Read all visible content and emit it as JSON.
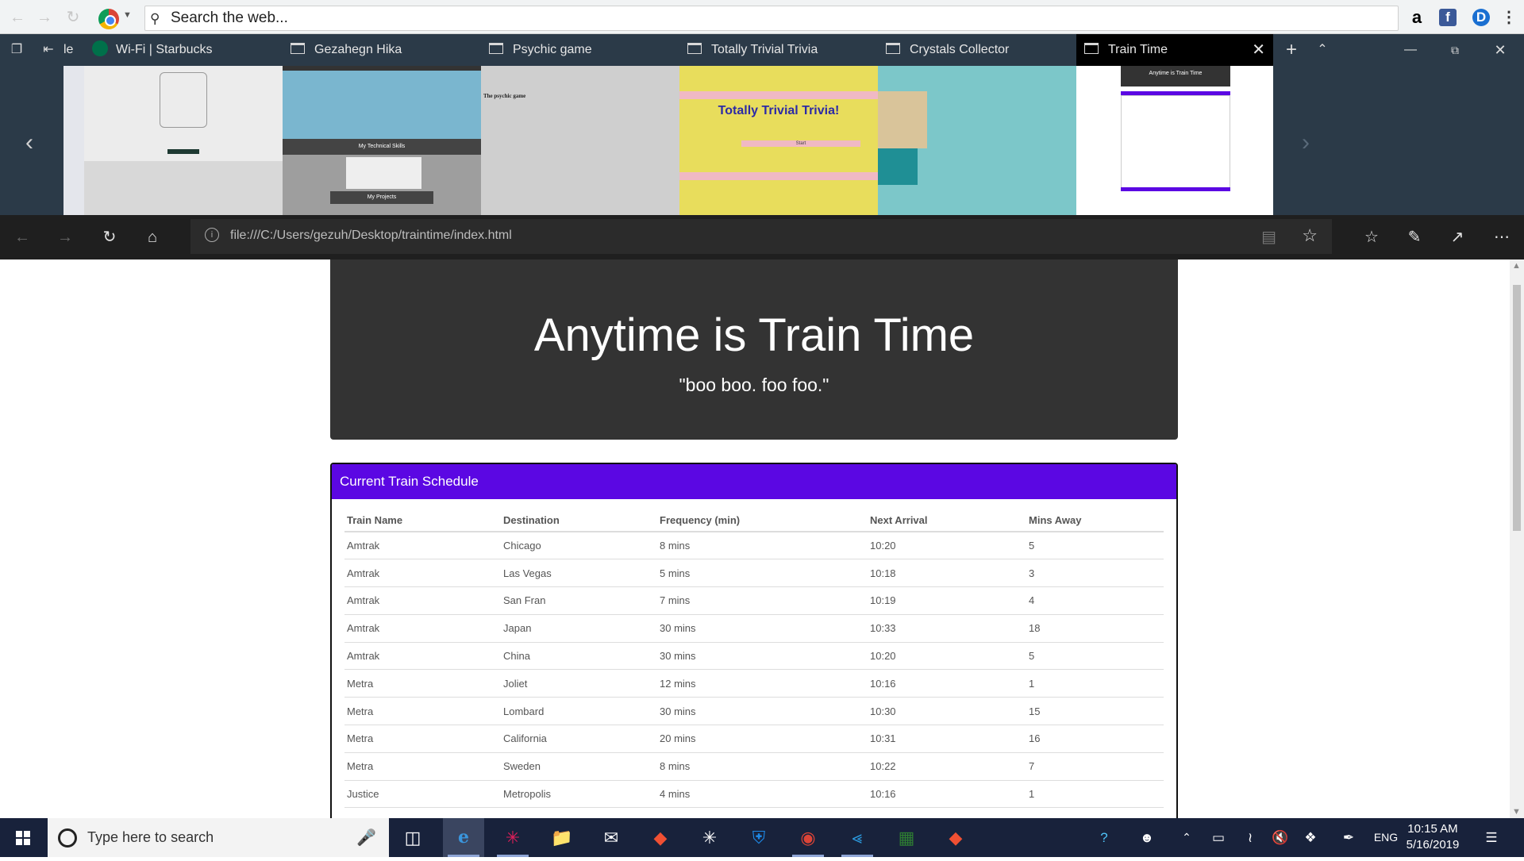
{
  "toolbar": {
    "search_placeholder": "Search the web..."
  },
  "tabs": [
    {
      "label": "le"
    },
    {
      "label": "Wi-Fi | Starbucks"
    },
    {
      "label": "Gezahegn Hika"
    },
    {
      "label": "Psychic game"
    },
    {
      "label": "Totally Trivial Trivia"
    },
    {
      "label": "Crystals Collector"
    },
    {
      "label": "Train Time",
      "active": true
    }
  ],
  "previews": {
    "trivia_title": "Totally Trivial Trivia!",
    "trivia_button": "Start",
    "psychic_title": "The psychic game",
    "skills_label": "My Technical Skills",
    "projects_label": "My Projects",
    "train_title": "Anytime is Train Time"
  },
  "address_bar": {
    "url": "file:///C:/Users/gezuh/Desktop/traintime/index.html"
  },
  "page": {
    "title": "Anytime is Train Time",
    "subtitle": "\"boo boo. foo foo.\"",
    "panel_heading": "Current Train Schedule",
    "columns": [
      "Train Name",
      "Destination",
      "Frequency (min)",
      "Next Arrival",
      "Mins Away"
    ],
    "rows": [
      [
        "Amtrak",
        "Chicago",
        "8 mins",
        "10:20",
        "5"
      ],
      [
        "Amtrak",
        "Las Vegas",
        "5 mins",
        "10:18",
        "3"
      ],
      [
        "Amtrak",
        "San Fran",
        "7 mins",
        "10:19",
        "4"
      ],
      [
        "Amtrak",
        "Japan",
        "30 mins",
        "10:33",
        "18"
      ],
      [
        "Amtrak",
        "China",
        "30 mins",
        "10:20",
        "5"
      ],
      [
        "Metra",
        "Joliet",
        "12 mins",
        "10:16",
        "1"
      ],
      [
        "Metra",
        "Lombard",
        "30 mins",
        "10:30",
        "15"
      ],
      [
        "Metra",
        "California",
        "20 mins",
        "10:31",
        "16"
      ],
      [
        "Metra",
        "Sweden",
        "8 mins",
        "10:22",
        "7"
      ],
      [
        "Justice",
        "Metropolis",
        "4 mins",
        "10:16",
        "1"
      ]
    ]
  },
  "taskbar": {
    "search_placeholder": "Type here to search",
    "language": "ENG",
    "time": "10:15 AM",
    "date": "5/16/2019"
  },
  "colors": {
    "panel_header": "#5b07e3",
    "jumbotron": "#333333",
    "taskbar": "#18223b",
    "tabstrip": "#2b3a48"
  }
}
